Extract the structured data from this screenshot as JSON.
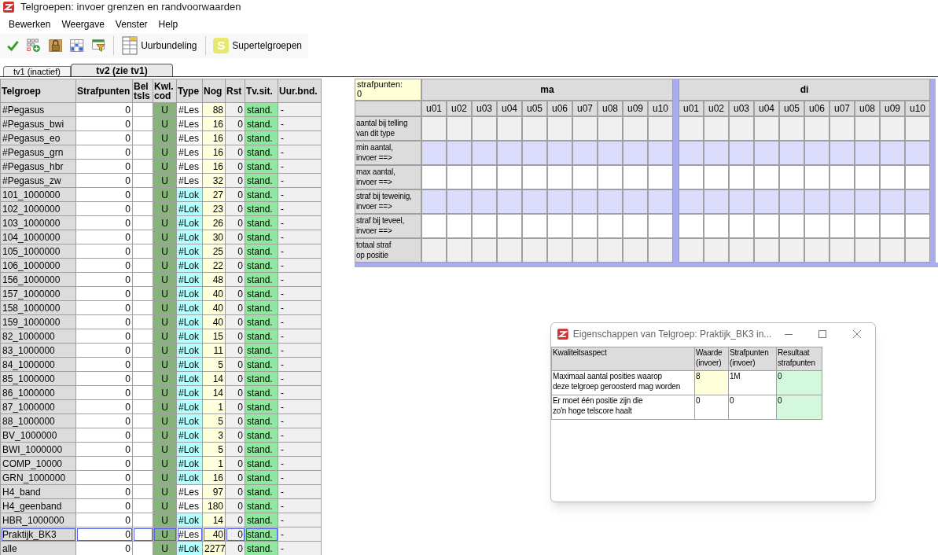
{
  "window": {
    "title": "Telgroepen: invoer grenzen en randvoorwaarden"
  },
  "menu": [
    "Bewerken",
    "Weergave",
    "Venster",
    "Help"
  ],
  "toolbar": [
    {
      "kind": "check"
    },
    {
      "kind": "grid-add"
    },
    {
      "kind": "lock"
    },
    {
      "kind": "grid"
    },
    {
      "kind": "filter"
    },
    {
      "kind": "separator"
    },
    {
      "kind": "columns",
      "label": "Uurbundeling"
    },
    {
      "kind": "separator"
    },
    {
      "kind": "letter",
      "letter": "S",
      "label": "Supertelgroepen"
    }
  ],
  "tabs": [
    {
      "label": "tv1 (inactief)",
      "selected": false
    },
    {
      "label": "tv2 (zie tv1)",
      "selected": true
    }
  ],
  "table": {
    "columns": [
      "Telgroep",
      "Strafpunten",
      "Bel tsls",
      "Kwl. cod",
      "Type",
      "Nog",
      "Rst",
      "Tv.sit.",
      "Uur.bnd."
    ],
    "rows": [
      {
        "name": "#Pegasus",
        "strafpunten": "0",
        "kwl": "U",
        "type": "#Les",
        "color": "#ffffff",
        "nog": "88",
        "rst": "0",
        "tvsit": "stand.",
        "uurbnd": "-",
        "selected": false
      },
      {
        "name": "#Pegasus_bwi",
        "strafpunten": "0",
        "kwl": "U",
        "type": "#Les",
        "color": "#ffffff",
        "nog": "16",
        "rst": "0",
        "tvsit": "stand.",
        "uurbnd": "-",
        "selected": false
      },
      {
        "name": "#Pegasus_eo",
        "strafpunten": "0",
        "kwl": "U",
        "type": "#Les",
        "color": "#ffffff",
        "nog": "16",
        "rst": "0",
        "tvsit": "stand.",
        "uurbnd": "-",
        "selected": false
      },
      {
        "name": "#Pegasus_grn",
        "strafpunten": "0",
        "kwl": "U",
        "type": "#Les",
        "color": "#ffffff",
        "nog": "16",
        "rst": "0",
        "tvsit": "stand.",
        "uurbnd": "-",
        "selected": false
      },
      {
        "name": "#Pegasus_hbr",
        "strafpunten": "0",
        "kwl": "U",
        "type": "#Les",
        "color": "#ffffff",
        "nog": "16",
        "rst": "0",
        "tvsit": "stand.",
        "uurbnd": "-",
        "selected": false
      },
      {
        "name": "#Pegasus_zw",
        "strafpunten": "0",
        "kwl": "U",
        "type": "#Les",
        "color": "#ffffff",
        "nog": "32",
        "rst": "0",
        "tvsit": "stand.",
        "uurbnd": "-",
        "selected": false
      },
      {
        "name": "101_1000000",
        "strafpunten": "0",
        "kwl": "U",
        "type": "#Lok",
        "color": "#b4ffff",
        "nog": "27",
        "rst": "0",
        "tvsit": "stand.",
        "uurbnd": "-",
        "selected": false
      },
      {
        "name": "102_1000000",
        "strafpunten": "0",
        "kwl": "U",
        "type": "#Lok",
        "color": "#b4ffff",
        "nog": "23",
        "rst": "0",
        "tvsit": "stand.",
        "uurbnd": "-",
        "selected": false
      },
      {
        "name": "103_1000000",
        "strafpunten": "0",
        "kwl": "U",
        "type": "#Lok",
        "color": "#b4ffff",
        "nog": "26",
        "rst": "0",
        "tvsit": "stand.",
        "uurbnd": "-",
        "selected": false
      },
      {
        "name": "104_1000000",
        "strafpunten": "0",
        "kwl": "U",
        "type": "#Lok",
        "color": "#b4ffff",
        "nog": "30",
        "rst": "0",
        "tvsit": "stand.",
        "uurbnd": "-",
        "selected": false
      },
      {
        "name": "105_1000000",
        "strafpunten": "0",
        "kwl": "U",
        "type": "#Lok",
        "color": "#b4ffff",
        "nog": "25",
        "rst": "0",
        "tvsit": "stand.",
        "uurbnd": "-",
        "selected": false
      },
      {
        "name": "106_1000000",
        "strafpunten": "0",
        "kwl": "U",
        "type": "#Lok",
        "color": "#b4ffff",
        "nog": "22",
        "rst": "0",
        "tvsit": "stand.",
        "uurbnd": "-",
        "selected": false
      },
      {
        "name": "156_1000000",
        "strafpunten": "0",
        "kwl": "U",
        "type": "#Lok",
        "color": "#b4ffff",
        "nog": "48",
        "rst": "0",
        "tvsit": "stand.",
        "uurbnd": "-",
        "selected": false
      },
      {
        "name": "157_1000000",
        "strafpunten": "0",
        "kwl": "U",
        "type": "#Lok",
        "color": "#b4ffff",
        "nog": "40",
        "rst": "0",
        "tvsit": "stand.",
        "uurbnd": "-",
        "selected": false
      },
      {
        "name": "158_1000000",
        "strafpunten": "0",
        "kwl": "U",
        "type": "#Lok",
        "color": "#b4ffff",
        "nog": "40",
        "rst": "0",
        "tvsit": "stand.",
        "uurbnd": "-",
        "selected": false
      },
      {
        "name": "159_1000000",
        "strafpunten": "0",
        "kwl": "U",
        "type": "#Lok",
        "color": "#b4ffff",
        "nog": "40",
        "rst": "0",
        "tvsit": "stand.",
        "uurbnd": "-",
        "selected": false
      },
      {
        "name": "82_1000000",
        "strafpunten": "0",
        "kwl": "U",
        "type": "#Lok",
        "color": "#b4ffff",
        "nog": "15",
        "rst": "0",
        "tvsit": "stand.",
        "uurbnd": "-",
        "selected": false
      },
      {
        "name": "83_1000000",
        "strafpunten": "0",
        "kwl": "U",
        "type": "#Lok",
        "color": "#b4ffff",
        "nog": "11",
        "rst": "0",
        "tvsit": "stand.",
        "uurbnd": "-",
        "selected": false
      },
      {
        "name": "84_1000000",
        "strafpunten": "0",
        "kwl": "U",
        "type": "#Lok",
        "color": "#b4ffff",
        "nog": "5",
        "rst": "0",
        "tvsit": "stand.",
        "uurbnd": "-",
        "selected": false
      },
      {
        "name": "85_1000000",
        "strafpunten": "0",
        "kwl": "U",
        "type": "#Lok",
        "color": "#b4ffff",
        "nog": "14",
        "rst": "0",
        "tvsit": "stand.",
        "uurbnd": "-",
        "selected": false
      },
      {
        "name": "86_1000000",
        "strafpunten": "0",
        "kwl": "U",
        "type": "#Lok",
        "color": "#b4ffff",
        "nog": "14",
        "rst": "0",
        "tvsit": "stand.",
        "uurbnd": "-",
        "selected": false
      },
      {
        "name": "87_1000000",
        "strafpunten": "0",
        "kwl": "U",
        "type": "#Lok",
        "color": "#b4ffff",
        "nog": "1",
        "rst": "0",
        "tvsit": "stand.",
        "uurbnd": "-",
        "selected": false
      },
      {
        "name": "88_1000000",
        "strafpunten": "0",
        "kwl": "U",
        "type": "#Lok",
        "color": "#b4ffff",
        "nog": "5",
        "rst": "0",
        "tvsit": "stand.",
        "uurbnd": "-",
        "selected": false
      },
      {
        "name": "BV_1000000",
        "strafpunten": "0",
        "kwl": "U",
        "type": "#Lok",
        "color": "#b4ffff",
        "nog": "3",
        "rst": "0",
        "tvsit": "stand.",
        "uurbnd": "-",
        "selected": false
      },
      {
        "name": "BWI_1000000",
        "strafpunten": "0",
        "kwl": "U",
        "type": "#Lok",
        "color": "#b4ffff",
        "nog": "5",
        "rst": "0",
        "tvsit": "stand.",
        "uurbnd": "-",
        "selected": false
      },
      {
        "name": "COMP_10000",
        "strafpunten": "0",
        "kwl": "U",
        "type": "#Lok",
        "color": "#b4ffff",
        "nog": "1",
        "rst": "0",
        "tvsit": "stand.",
        "uurbnd": "-",
        "selected": false
      },
      {
        "name": "GRN_1000000",
        "strafpunten": "0",
        "kwl": "U",
        "type": "#Lok",
        "color": "#b4ffff",
        "nog": "16",
        "rst": "0",
        "tvsit": "stand.",
        "uurbnd": "-",
        "selected": false
      },
      {
        "name": "H4_band",
        "strafpunten": "0",
        "kwl": "U",
        "type": "#Les",
        "color": "#ffffff",
        "nog": "97",
        "rst": "0",
        "tvsit": "stand.",
        "uurbnd": "-",
        "selected": false
      },
      {
        "name": "H4_geenband",
        "strafpunten": "0",
        "kwl": "U",
        "type": "#Les",
        "color": "#ffffff",
        "nog": "180",
        "rst": "0",
        "tvsit": "stand.",
        "uurbnd": "-",
        "selected": false
      },
      {
        "name": "HBR_1000000",
        "strafpunten": "0",
        "kwl": "U",
        "type": "#Lok",
        "color": "#b4ffff",
        "nog": "14",
        "rst": "0",
        "tvsit": "stand.",
        "uurbnd": "-",
        "selected": false
      },
      {
        "name": "Praktijk_BK3",
        "strafpunten": "0",
        "kwl": "U",
        "type": "#Les",
        "color": "#ffffff",
        "nog": "40",
        "rst": "0",
        "tvsit": "stand.",
        "uurbnd": "-",
        "selected": true
      },
      {
        "name": "alle",
        "strafpunten": "0",
        "kwl": "U",
        "type": "#Lok",
        "color": "#b4ffff",
        "nog": "2277",
        "rst": "0",
        "tvsit": "stand.",
        "uurbnd": "-",
        "selected": false
      }
    ]
  },
  "schedule": {
    "total": "strafpunten:\n0",
    "days": [
      {
        "name": "ma",
        "slots": [
          "u01",
          "u02",
          "u03",
          "u04",
          "u05",
          "u06",
          "u07",
          "u08",
          "u09",
          "u10"
        ]
      },
      {
        "name": "di",
        "slots": [
          "u01",
          "u02",
          "u03",
          "u04",
          "u05",
          "u06",
          "u07",
          "u08",
          "u09",
          "u10"
        ]
      }
    ],
    "rows": [
      {
        "label": "aantal bij telling\nvan dit type",
        "kind": "readonly"
      },
      {
        "label": "min aantal,\ninvoer ==>",
        "kind": "shaded"
      },
      {
        "label": "max aantal,\ninvoer ==>",
        "kind": "input"
      },
      {
        "label": "straf bij teweinig,\ninvoer ==>",
        "kind": "shaded"
      },
      {
        "label": "straf bij teveel,\ninvoer ==>",
        "kind": "input"
      },
      {
        "label": "totaal straf\nop positie",
        "kind": "readonly"
      }
    ]
  },
  "dialog": {
    "title": "Eigenschappen van Telgroep: Praktijk_BK3 in...",
    "columns": [
      "Kwaliteitsaspect",
      "Waarde\n(invoer)",
      "Strafpunten\n(invoer)",
      "Resultaat\nstrafpunten"
    ],
    "rows": [
      {
        "aspect": "Maximaal aantal posities waarop\ndeze telgroep geroosterd mag worden",
        "waarde": "8",
        "strafpunten": "1M",
        "resultaat": "0",
        "selected": true
      },
      {
        "aspect": "Er moet één positie zijn die\nzo'n hoge telscore haalt",
        "waarde": "0",
        "strafpunten": "0",
        "resultaat": "0",
        "selected": false
      }
    ]
  }
}
